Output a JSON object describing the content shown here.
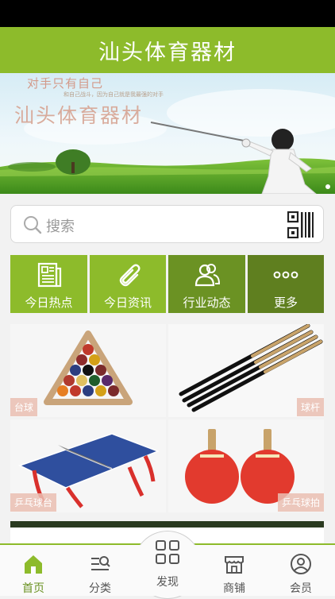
{
  "app": {
    "title": "汕头体育器材"
  },
  "banner": {
    "tagline": "对手只有自己",
    "subtag": "和自己战斗，因为自己就是我最强的对手",
    "title": "汕头体育器材"
  },
  "search": {
    "placeholder": "搜索",
    "icon": "search-icon",
    "qr_icon": "qr-code-icon"
  },
  "quick_nav": [
    {
      "label": "今日热点",
      "icon": "newspaper-icon"
    },
    {
      "label": "今日资讯",
      "icon": "paperclip-icon"
    },
    {
      "label": "行业动态",
      "icon": "users-icon"
    },
    {
      "label": "更多",
      "icon": "more-dots-icon"
    }
  ],
  "products": [
    {
      "label": "台球"
    },
    {
      "label": "球杆"
    },
    {
      "label": "乒乓球台"
    },
    {
      "label": "乒乓球拍"
    }
  ],
  "bottom_nav": [
    {
      "label": "首页",
      "icon": "home-icon",
      "active": true
    },
    {
      "label": "分类",
      "icon": "category-icon"
    },
    {
      "label": "发现",
      "icon": "discover-grid-icon"
    },
    {
      "label": "商铺",
      "icon": "shop-icon"
    },
    {
      "label": "会员",
      "icon": "user-icon"
    }
  ],
  "colors": {
    "accent": "#8dbb2b",
    "accent_dark": "#6b9223",
    "accent_darker": "#5f7f1f"
  }
}
